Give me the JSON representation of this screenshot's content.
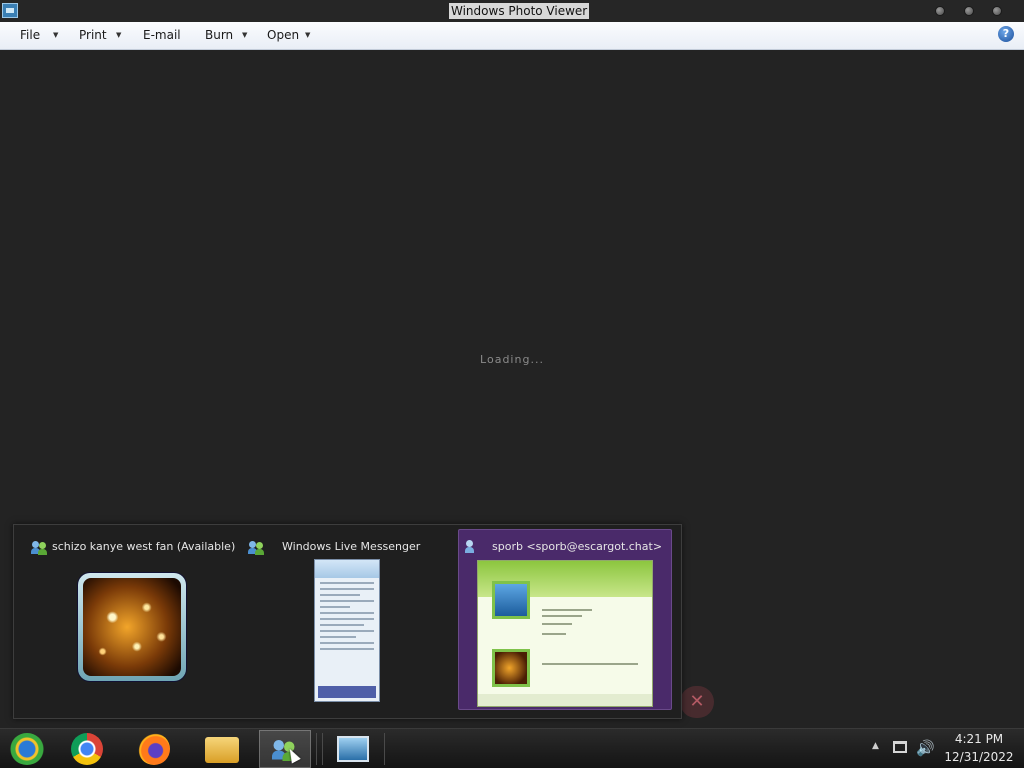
{
  "window": {
    "title": "Windows Photo Viewer"
  },
  "menu": {
    "file": "File",
    "print": "Print",
    "email": "E-mail",
    "burn": "Burn",
    "open": "Open",
    "arrow": "▼",
    "help": "?"
  },
  "main": {
    "status": "Loading..."
  },
  "taskbar_peek": {
    "items": [
      {
        "label": "schizo kanye west fan (Available)"
      },
      {
        "label": "Windows Live Messenger"
      },
      {
        "label": "sporb <sporb@escargot.chat>"
      }
    ]
  },
  "tray": {
    "arrow": "▲",
    "volume": "🔊",
    "time": "4:21 PM",
    "date": "12/31/2022"
  },
  "ghost": {
    "close": "✕"
  },
  "colors": {
    "background": "#232323",
    "menubar": "#eef2f8",
    "active_peek": "#4a2a6a",
    "messenger_green": "#8cc63f"
  },
  "icons": [
    "internet-explorer-icon",
    "chrome-icon",
    "firefox-icon",
    "folder-icon",
    "messenger-icon",
    "photo-viewer-icon",
    "network-icon",
    "volume-icon",
    "help-icon"
  ]
}
